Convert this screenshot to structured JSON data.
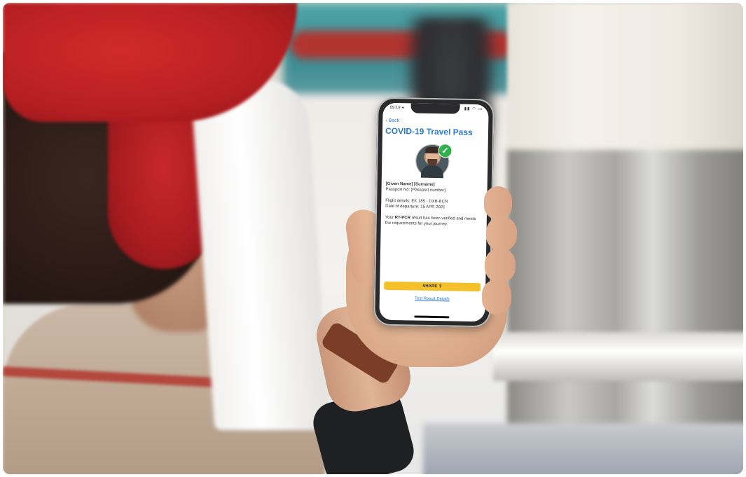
{
  "phone_screen": {
    "status_time": "09:19 ◂",
    "status_icons": "▮▮ ◠ ▭",
    "back_label": "‹ Back",
    "title": "COVID-19 Travel Pass",
    "verified_icon": "check-circle-icon",
    "name": "[Given Name] [Surname]",
    "passport": "Passport No: [Passport number]",
    "flight_details": "Flight details: EK 185 - DXB-BCN",
    "departure_date": "Date of departure: 15 APR 2021",
    "result_prefix": "Your ",
    "result_bold": "RT-PCR",
    "result_suffix": " result has been verified and meets the requirements for your journey.",
    "share_label": "SHARE ⇪",
    "details_link": "Test Result Details"
  },
  "colors": {
    "accent_blue": "#2b7bd6",
    "share_yellow": "#f4c12a",
    "verified_green": "#2fb24c"
  }
}
